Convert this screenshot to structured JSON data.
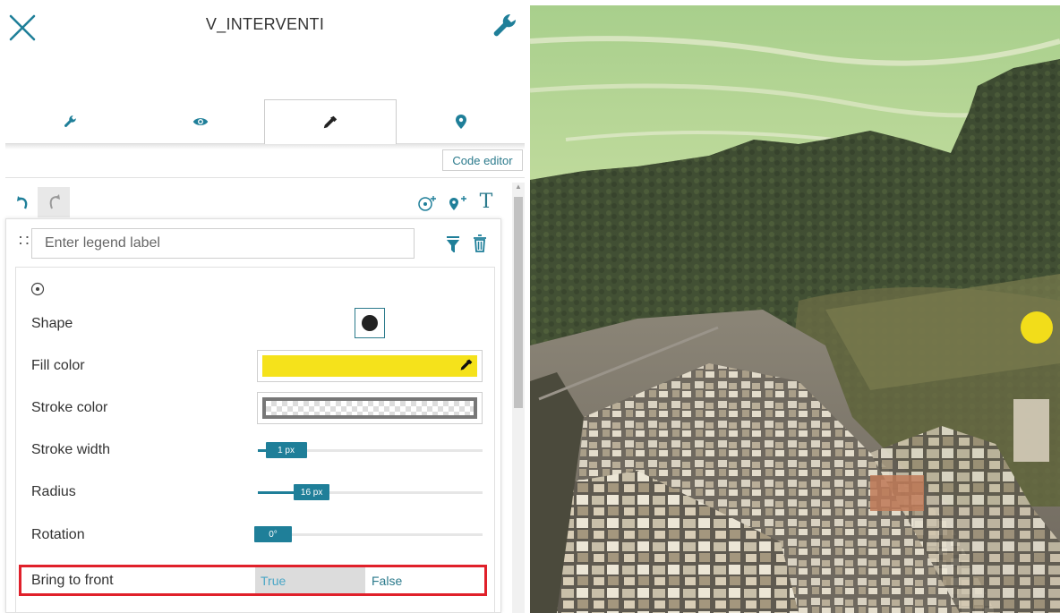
{
  "header": {
    "title": "V_INTERVENTI",
    "close_icon": "close-x-icon",
    "settings_icon": "wrench-icon"
  },
  "tabs": [
    {
      "id": "settings",
      "icon": "wrench-icon",
      "active": false
    },
    {
      "id": "visibility",
      "icon": "eye-icon",
      "active": false
    },
    {
      "id": "style",
      "icon": "eyedropper-icon",
      "active": true
    },
    {
      "id": "location",
      "icon": "map-pin-icon",
      "active": false
    }
  ],
  "toolbar": {
    "code_editor_label": "Code editor",
    "undo_icon": "undo-icon",
    "redo_icon": "redo-icon",
    "add_symbol_icon": "add-point-symbol-icon",
    "add_marker_icon": "add-marker-icon",
    "add_text_label": "T"
  },
  "legend": {
    "label_value": "",
    "label_placeholder": "Enter legend label",
    "drag_handle": "∷",
    "filter_icon": "filter-icon",
    "delete_icon": "trash-icon"
  },
  "style": {
    "point_type_icon": "point-symbol-icon",
    "shape": {
      "label": "Shape",
      "value": "circle"
    },
    "fill_color": {
      "label": "Fill color",
      "value": "#f5e21b"
    },
    "stroke_color": {
      "label": "Stroke color",
      "value": "transparent"
    },
    "stroke_width": {
      "label": "Stroke width",
      "value_text": "1 px",
      "value": 1,
      "max": 50
    },
    "radius": {
      "label": "Radius",
      "value_text": "16 px",
      "value": 16,
      "max": 100
    },
    "rotation": {
      "label": "Rotation",
      "value_text": "0°",
      "value": 0,
      "max": 360
    },
    "bring_to_front": {
      "label": "Bring to front",
      "true_label": "True",
      "false_label": "False",
      "selected": "True"
    }
  },
  "map": {
    "marker_color": "#f2dd1a",
    "description": "3d-terrain-view"
  },
  "colors": {
    "accent": "#1f7f99",
    "highlight": "#e0202a"
  }
}
